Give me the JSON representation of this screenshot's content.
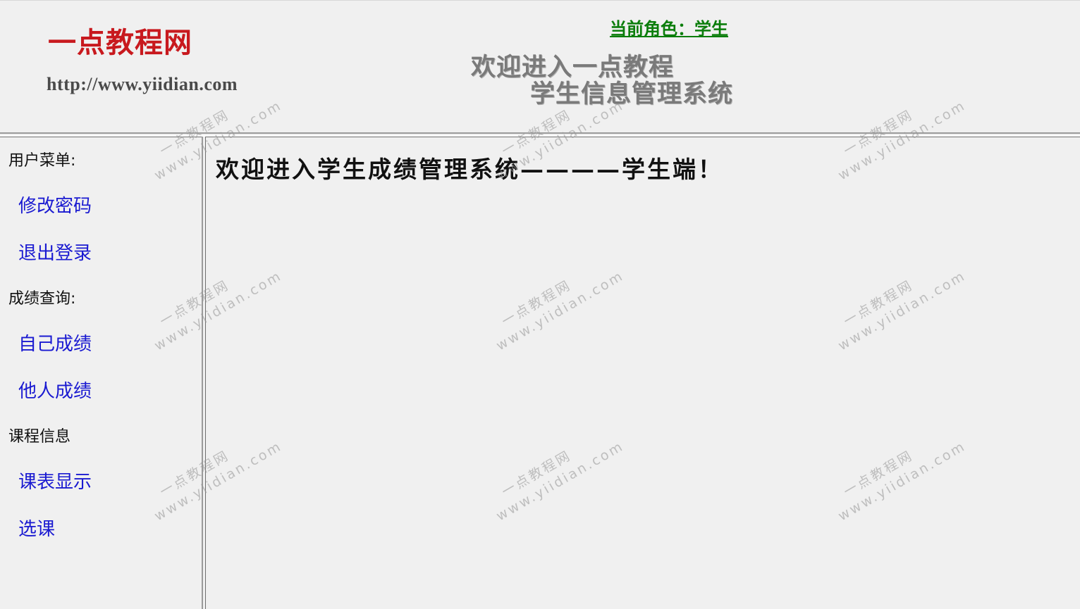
{
  "header": {
    "logo_title": "一点教程网",
    "logo_url": "http://www.yiidian.com",
    "role_link": "当前角色：学生",
    "welcome_line1": "欢迎进入一点教程",
    "welcome_line2": "学生信息管理系统"
  },
  "sidebar": {
    "sections": [
      {
        "label": "用户菜单:",
        "items": [
          {
            "label": "修改密码"
          },
          {
            "label": "退出登录"
          }
        ]
      },
      {
        "label": "成绩查询:",
        "items": [
          {
            "label": "自己成绩"
          },
          {
            "label": "他人成绩"
          }
        ]
      },
      {
        "label": "课程信息",
        "items": [
          {
            "label": "课表显示"
          },
          {
            "label": "选课"
          }
        ]
      }
    ]
  },
  "main": {
    "heading": "欢迎进入学生成绩管理系统————学生端！"
  },
  "watermark": {
    "line1": "一点教程网",
    "line2": "www.yiidian.com"
  },
  "colors": {
    "logo_red": "#c8191e",
    "role_green": "#0b7d0b",
    "link_blue": "#1a1ad1",
    "background": "#f0f0f0"
  }
}
